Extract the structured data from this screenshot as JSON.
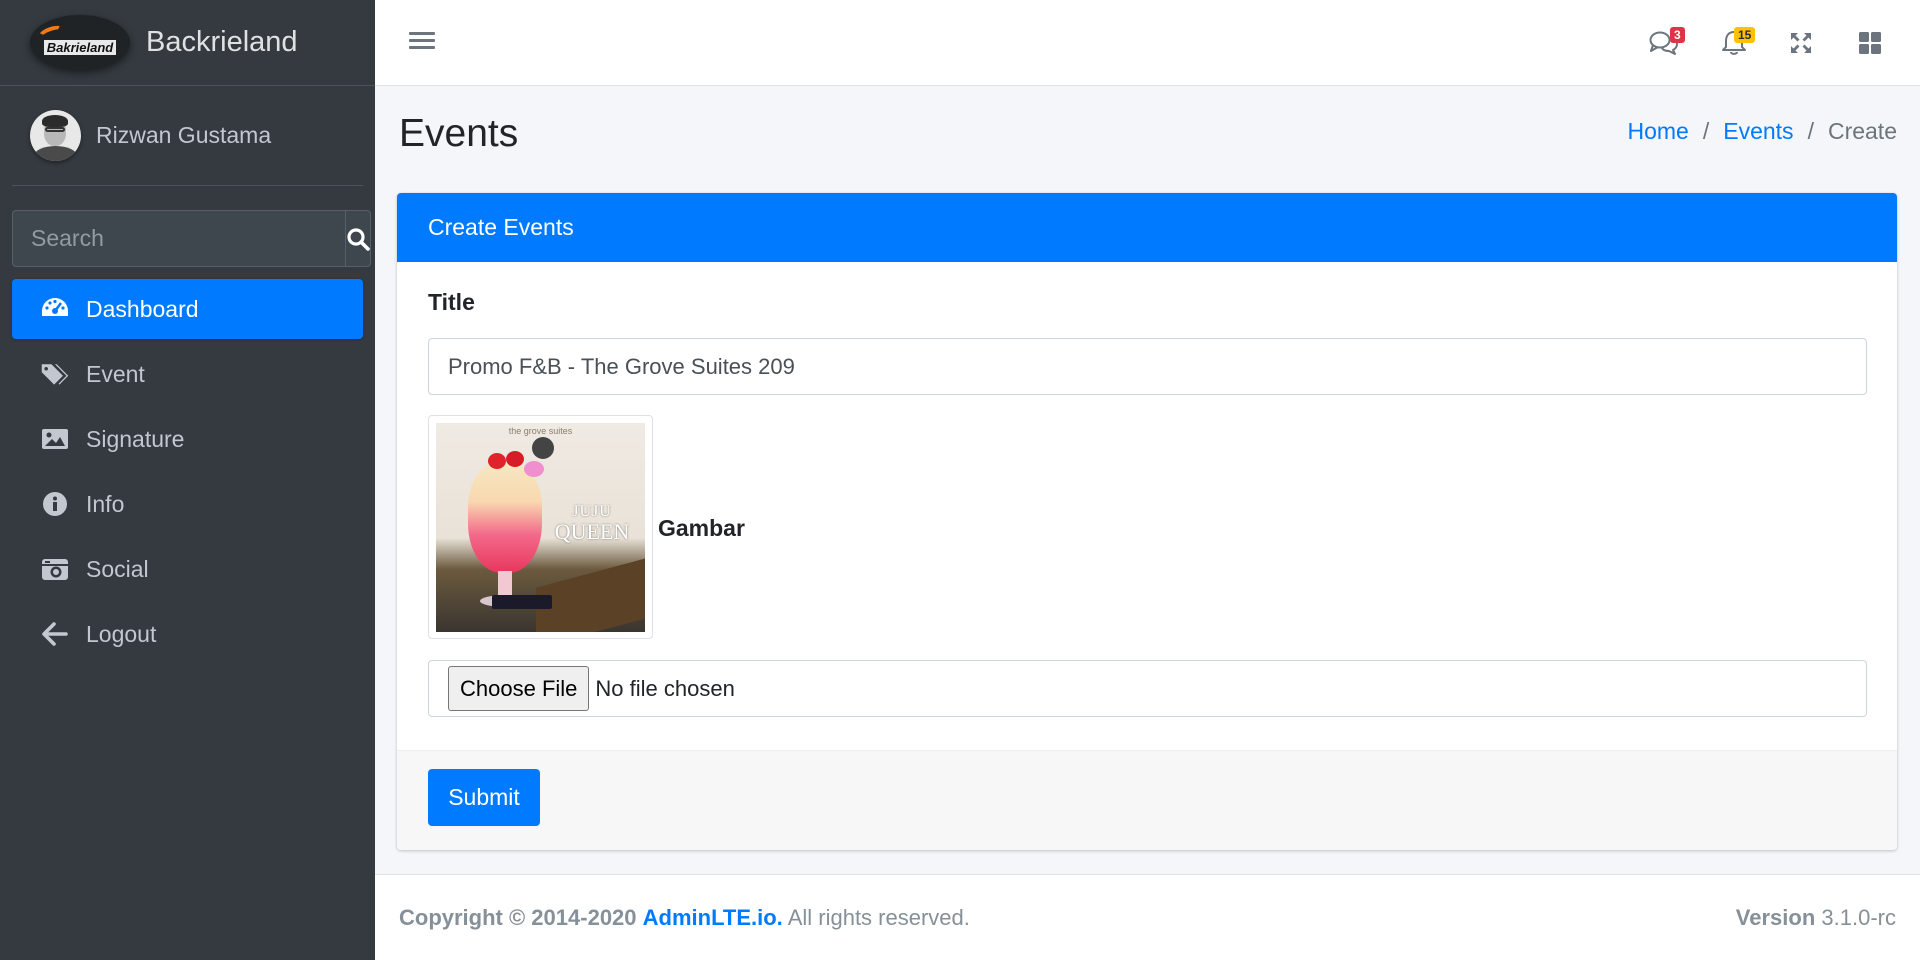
{
  "brand": {
    "name": "Backrieland",
    "logo_text": "Bakrieland"
  },
  "user": {
    "name": "Rizwan Gustama"
  },
  "sidebar_search": {
    "placeholder": "Search"
  },
  "nav": [
    {
      "label": "Dashboard",
      "icon": "tachometer-icon",
      "active": true
    },
    {
      "label": "Event",
      "icon": "tags-icon",
      "active": false
    },
    {
      "label": "Signature",
      "icon": "image-icon",
      "active": false
    },
    {
      "label": "Info",
      "icon": "info-circle-icon",
      "active": false
    },
    {
      "label": "Social",
      "icon": "camera-retro-icon",
      "active": false
    },
    {
      "label": "Logout",
      "icon": "arrow-left-icon",
      "active": false
    }
  ],
  "topbar": {
    "messages_count": "3",
    "notifications_count": "15"
  },
  "page": {
    "title": "Events",
    "breadcrumb": [
      "Home",
      "Events",
      "Create"
    ]
  },
  "card": {
    "header": "Create Events",
    "title_label": "Title",
    "title_value": "Promo F&B - The Grove Suites 209",
    "image_label": "Gambar",
    "image_texts": {
      "brand": "the grove suites",
      "line1": "JUJU",
      "line2": "QUEEN"
    },
    "file_button": "Choose File",
    "file_status": "No file chosen",
    "submit_label": "Submit"
  },
  "footer": {
    "copyright_prefix": "Copyright © 2014-2020",
    "link": "AdminLTE.io.",
    "suffix": "All rights reserved.",
    "version_label": "Version",
    "version_value": "3.1.0-rc"
  },
  "colors": {
    "primary": "#007bff",
    "sidebar_bg": "#343a40",
    "danger": "#dc3545",
    "warning": "#ffc107"
  }
}
